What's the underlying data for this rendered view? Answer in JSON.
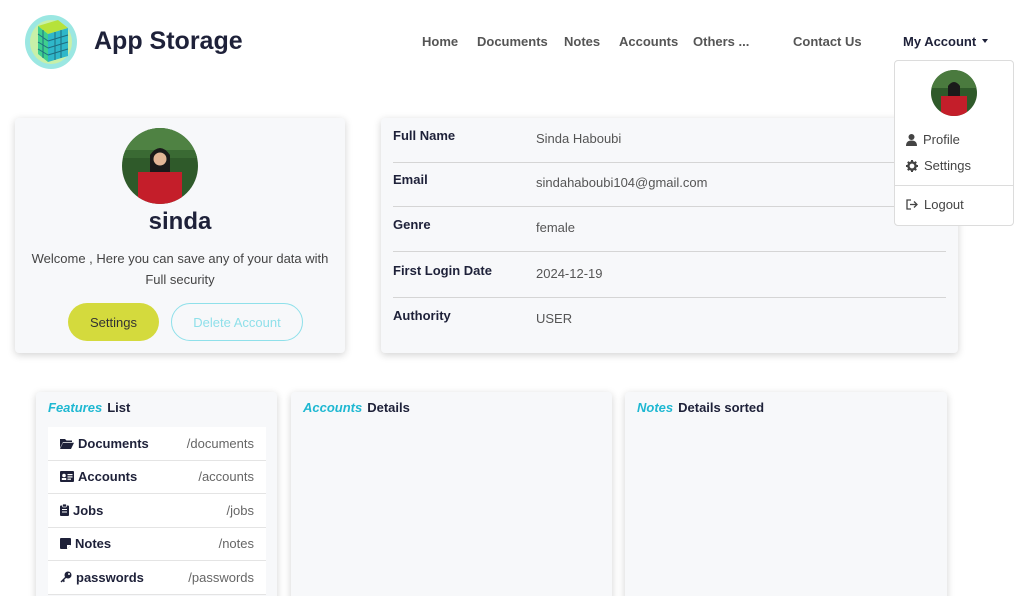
{
  "brand": {
    "name": "App Storage"
  },
  "nav": {
    "items": [
      "Home",
      "Documents",
      "Notes",
      "Accounts",
      "Others ...",
      "Contact Us"
    ],
    "account_label": "My Account"
  },
  "dropdown": {
    "items": [
      {
        "label": "Profile",
        "icon": "user-icon"
      },
      {
        "label": "Settings",
        "icon": "gear-icon"
      },
      {
        "label": "Logout",
        "icon": "logout-icon"
      }
    ]
  },
  "profile": {
    "username": "sinda",
    "welcome": "Welcome , Here you can save any of your data with Full security",
    "settings_label": "Settings",
    "delete_label": "Delete Account"
  },
  "info": {
    "rows": [
      {
        "label": "Full Name",
        "value": "Sinda Haboubi"
      },
      {
        "label": "Email",
        "value": "sindahaboubi104@gmail.com"
      },
      {
        "label": "Genre",
        "value": "female"
      },
      {
        "label": "First Login Date",
        "value": "2024-12-19"
      },
      {
        "label": "Authority",
        "value": "USER"
      }
    ]
  },
  "features": {
    "title_accent": "Features",
    "title_rest": "List",
    "items": [
      {
        "name": "Documents",
        "path": "/documents",
        "icon": "folder-open-icon"
      },
      {
        "name": "Accounts",
        "path": "/accounts",
        "icon": "id-card-icon"
      },
      {
        "name": "Jobs",
        "path": "/jobs",
        "icon": "clipboard-icon"
      },
      {
        "name": "Notes",
        "path": "/notes",
        "icon": "sticky-note-icon"
      },
      {
        "name": "passwords",
        "path": "/passwords",
        "icon": "key-icon"
      }
    ]
  },
  "accounts_card": {
    "title_accent": "Accounts",
    "title_rest": "Details"
  },
  "notes_card": {
    "title_accent": "Notes",
    "title_rest": "Details sorted"
  },
  "colors": {
    "accent": "#1fb8d2",
    "settings_button": "#d4da3d",
    "brand_dark": "#1e2139"
  }
}
